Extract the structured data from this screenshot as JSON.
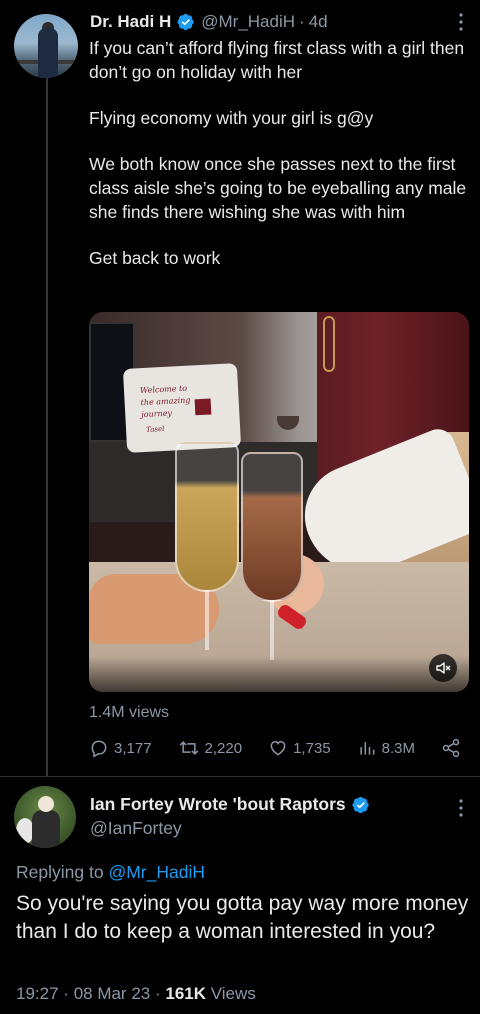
{
  "main_tweet": {
    "author_name": "Dr. Hadi H",
    "handle": "@Mr_HadiH",
    "separator": "·",
    "time": "4d",
    "paragraphs": [
      "If you can’t afford flying first class with a girl then don’t go on holiday with her",
      "Flying economy with your girl is g@y",
      "We both know once she passes next to the first class aisle she’s going to be eyeballing any male she finds there wishing she was with him",
      "Get back to work"
    ],
    "media": {
      "cushion_text": [
        "Welcome to",
        "the amazing",
        "journey"
      ],
      "cushion_brand": "Tasel"
    },
    "views": "1.4M views",
    "actions": {
      "replies": "3,177",
      "retweets": "2,220",
      "likes": "1,735",
      "views": "8.3M"
    }
  },
  "reply_tweet": {
    "author_name": "Ian Fortey Wrote 'bout Raptors",
    "handle": "@IanFortey",
    "replying_prefix": "Replying to",
    "replying_to": "@Mr_HadiH",
    "text": "So you're saying you gotta pay way more money than I do to keep a woman interested in you?",
    "time": "19:27",
    "date": "08 Mar 23",
    "view_count": "161K",
    "views_label": "Views",
    "separator": "·"
  },
  "colors": {
    "background": "#000000",
    "text": "#e7e9ea",
    "secondary": "#8b98a5",
    "accent": "#1d9bf0",
    "divider": "#2f3336"
  },
  "icons": [
    "verified-badge-icon",
    "more-icon",
    "reply-icon",
    "retweet-icon",
    "like-icon",
    "views-icon",
    "share-icon",
    "mute-icon"
  ]
}
